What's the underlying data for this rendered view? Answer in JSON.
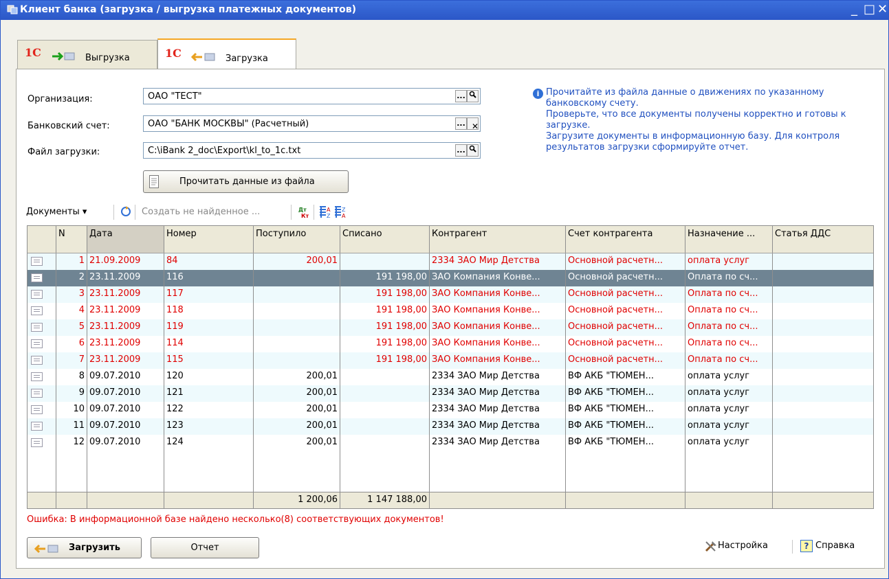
{
  "window": {
    "title": "Клиент банка (загрузка / выгрузка платежных документов)",
    "minimize": "_",
    "maximize": "□",
    "close": "✕"
  },
  "tabs": [
    {
      "logo": "1С",
      "label": "Выгрузка"
    },
    {
      "logo": "1С",
      "label": "Загрузка"
    }
  ],
  "form": {
    "org_label": "Организация:",
    "org_value": "ОАО \"ТЕСТ\"",
    "account_label": "Банковский счет:",
    "account_value": "ОАО \"БАНК МОСКВЫ\" (Расчетный)",
    "file_label": "Файл загрузки:",
    "file_value": "C:\\iBank 2_doc\\Export\\kl_to_1c.txt",
    "ellipsis": "...",
    "read_button": "Прочитать данные из файла"
  },
  "info": {
    "lines": [
      "Прочитайте из файла данные о движениях по указанному банковскому счету.",
      "Проверьте, что все  документы получены корректно и готовы к загрузке.",
      "Загрузите документы в информационную базу. Для контроля результатов загрузки сформируйте отчет."
    ]
  },
  "toolbar": {
    "documents": "Документы ▾",
    "create_not_found": "Создать не найденное ..."
  },
  "table": {
    "columns": [
      "N",
      "Дата",
      "Номер",
      "Поступило",
      "Списано",
      "Контрагент",
      "Счет контрагента",
      "Назначение ...",
      "Статья ДДС"
    ],
    "rows": [
      {
        "n": "1",
        "date": "21.09.2009",
        "num": "84",
        "in": "200,01",
        "out": "",
        "party": "2334 ЗАО Мир Детства",
        "acc": "Основной расчетн...",
        "purpose": "оплата услуг",
        "status": "error"
      },
      {
        "n": "2",
        "date": "23.11.2009",
        "num": "116",
        "in": "",
        "out": "191 198,00",
        "party": "ЗАО Компания Конве...",
        "acc": "Основной расчетн...",
        "purpose": "Оплата по сч...",
        "status": "selected"
      },
      {
        "n": "3",
        "date": "23.11.2009",
        "num": "117",
        "in": "",
        "out": "191 198,00",
        "party": "ЗАО Компания Конве...",
        "acc": "Основной расчетн...",
        "purpose": "Оплата по сч...",
        "status": "error"
      },
      {
        "n": "4",
        "date": "23.11.2009",
        "num": "118",
        "in": "",
        "out": "191 198,00",
        "party": "ЗАО Компания Конве...",
        "acc": "Основной расчетн...",
        "purpose": "Оплата по сч...",
        "status": "error"
      },
      {
        "n": "5",
        "date": "23.11.2009",
        "num": "119",
        "in": "",
        "out": "191 198,00",
        "party": "ЗАО Компания Конве...",
        "acc": "Основной расчетн...",
        "purpose": "Оплата по сч...",
        "status": "error"
      },
      {
        "n": "6",
        "date": "23.11.2009",
        "num": "114",
        "in": "",
        "out": "191 198,00",
        "party": "ЗАО Компания Конве...",
        "acc": "Основной расчетн...",
        "purpose": "Оплата по сч...",
        "status": "error"
      },
      {
        "n": "7",
        "date": "23.11.2009",
        "num": "115",
        "in": "",
        "out": "191 198,00",
        "party": "ЗАО Компания Конве...",
        "acc": "Основной расчетн...",
        "purpose": "Оплата по сч...",
        "status": "error"
      },
      {
        "n": "8",
        "date": "09.07.2010",
        "num": "120",
        "in": "200,01",
        "out": "",
        "party": "2334 ЗАО Мир Детства",
        "acc": "ВФ АКБ \"ТЮМЕН...",
        "purpose": "оплата услуг",
        "status": "ok"
      },
      {
        "n": "9",
        "date": "09.07.2010",
        "num": "121",
        "in": "200,01",
        "out": "",
        "party": "2334 ЗАО Мир Детства",
        "acc": "ВФ АКБ \"ТЮМЕН...",
        "purpose": "оплата услуг",
        "status": "ok"
      },
      {
        "n": "10",
        "date": "09.07.2010",
        "num": "122",
        "in": "200,01",
        "out": "",
        "party": "2334 ЗАО Мир Детства",
        "acc": "ВФ АКБ \"ТЮМЕН...",
        "purpose": "оплата услуг",
        "status": "ok"
      },
      {
        "n": "11",
        "date": "09.07.2010",
        "num": "123",
        "in": "200,01",
        "out": "",
        "party": "2334 ЗАО Мир Детства",
        "acc": "ВФ АКБ \"ТЮМЕН...",
        "purpose": "оплата услуг",
        "status": "ok"
      },
      {
        "n": "12",
        "date": "09.07.2010",
        "num": "124",
        "in": "200,01",
        "out": "",
        "party": "2334 ЗАО Мир Детства",
        "acc": "ВФ АКБ \"ТЮМЕН...",
        "purpose": "оплата услуг",
        "status": "ok"
      }
    ],
    "total_in": "1 200,06",
    "total_out": "1 147 188,00"
  },
  "error_message": "Ошибка: В информационной базе найдено несколько(8) соответствующих документов!",
  "buttons": {
    "load": "Загрузить",
    "report": "Отчет",
    "settings": "Настройка",
    "help": "Справка",
    "help_glyph": "?"
  },
  "colors": {
    "error_text": "#e00000",
    "selected_row": "#6f8493",
    "alt_row": "#eefafd",
    "info_text": "#1f4fbf",
    "title_bar": "#2b57c7"
  }
}
